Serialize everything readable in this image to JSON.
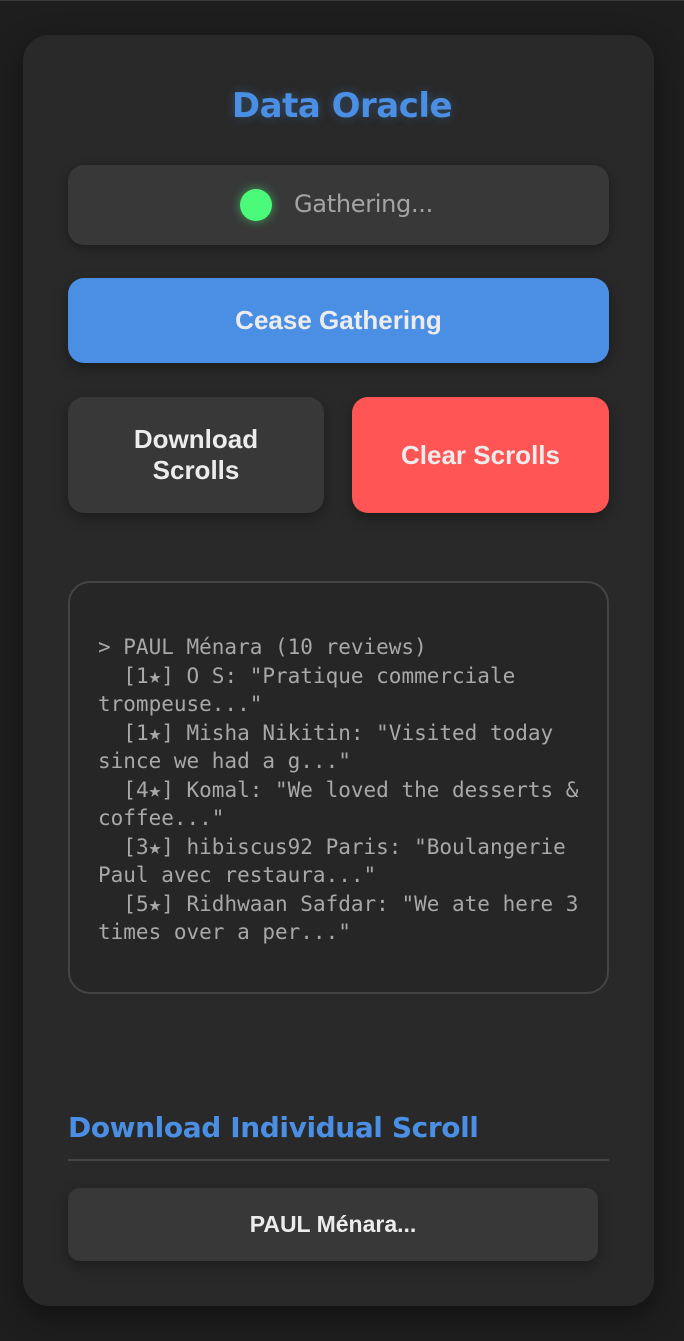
{
  "app": {
    "title": "Data Oracle"
  },
  "status": {
    "text": "Gathering...",
    "indicator_color": "#4cfa7a"
  },
  "buttons": {
    "cease": "Cease Gathering",
    "download": "Download Scrolls",
    "clear": "Clear Scrolls"
  },
  "log": {
    "lines": [
      "> PAUL Ménara (10 reviews)",
      "  [1★] O S: \"Pratique commerciale trompeuse...\"",
      "  [1★] Misha Nikitin: \"Visited today since we had a g...\"",
      "  [4★] Komal: \"We loved the desserts & coffee...\"",
      "  [3★] hibiscus92 Paris: \"Boulangerie Paul avec restaura...\"",
      "  [5★] Ridhwaan Safdar: \"We ate here 3 times over a per...\""
    ]
  },
  "individual": {
    "heading": "Download Individual Scroll",
    "items": [
      {
        "label": "PAUL Ménara..."
      }
    ]
  },
  "colors": {
    "accent": "#4a8fe3",
    "danger": "#ff5555",
    "panel": "#292929",
    "background": "#1e1e1e"
  }
}
